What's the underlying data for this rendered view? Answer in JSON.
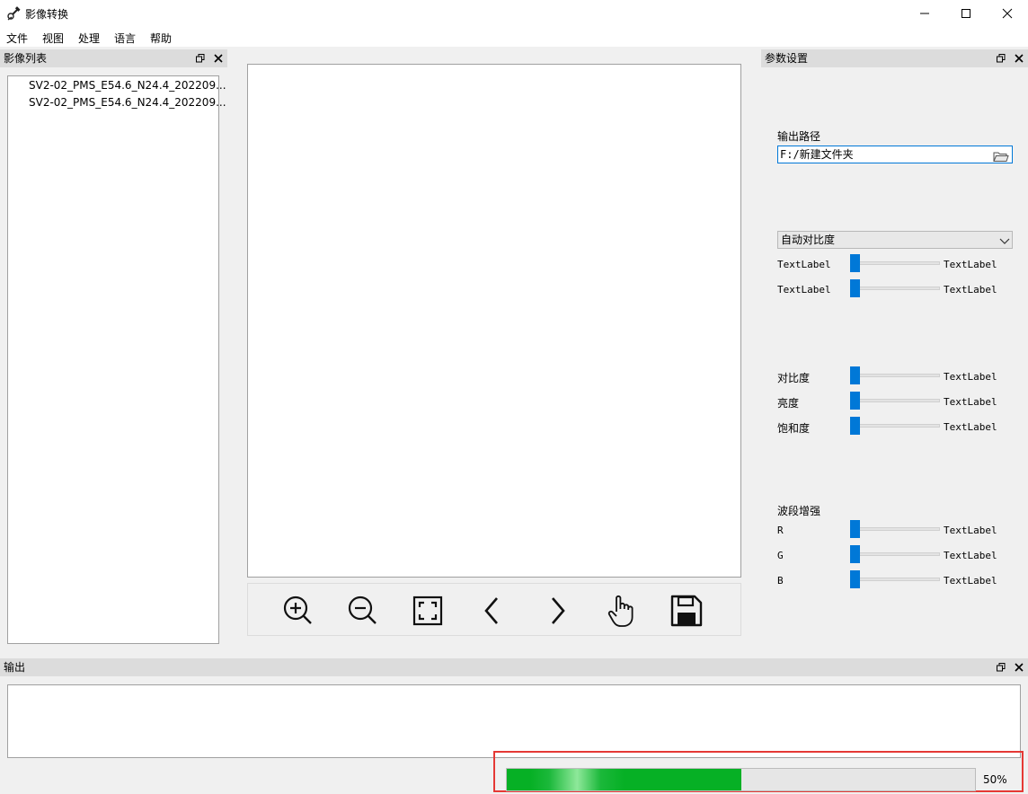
{
  "window": {
    "title": "影像转换",
    "controls": [
      "minimize",
      "maximize",
      "close"
    ]
  },
  "menu": {
    "items": [
      "文件",
      "视图",
      "处理",
      "语言",
      "帮助"
    ]
  },
  "image_list": {
    "title": "影像列表",
    "items": [
      "SV2-02_PMS_E54.6_N24.4_202209...",
      "SV2-02_PMS_E54.6_N24.4_202209..."
    ]
  },
  "toolbar": {
    "icons": [
      "zoom-in-icon",
      "zoom-out-icon",
      "fit-screen-icon",
      "chevron-left-icon",
      "chevron-right-icon",
      "hand-pan-icon",
      "save-icon"
    ]
  },
  "params": {
    "title": "参数设置",
    "output_path_label": "输出路径",
    "output_path_value": "F:/新建文件夹",
    "stretch_mode": "自动对比度",
    "stretch_sliders": [
      {
        "left": "TextLabel",
        "right": "TextLabel",
        "value": 0
      },
      {
        "left": "TextLabel",
        "right": "TextLabel",
        "value": 0
      }
    ],
    "adjust_sliders": [
      {
        "label": "对比度",
        "right": "TextLabel",
        "value": 0
      },
      {
        "label": "亮度",
        "right": "TextLabel",
        "value": 0
      },
      {
        "label": "饱和度",
        "right": "TextLabel",
        "value": 0
      }
    ],
    "band_title": "波段增强",
    "band_sliders": [
      {
        "label": "R",
        "right": "TextLabel",
        "value": 0
      },
      {
        "label": "G",
        "right": "TextLabel",
        "value": 0
      },
      {
        "label": "B",
        "right": "TextLabel",
        "value": 0
      }
    ]
  },
  "output": {
    "title": "输出",
    "log": ""
  },
  "progress": {
    "value": 0.5,
    "text": "50%",
    "fill_color": "#06b025",
    "highlight_color": "#e53935"
  }
}
